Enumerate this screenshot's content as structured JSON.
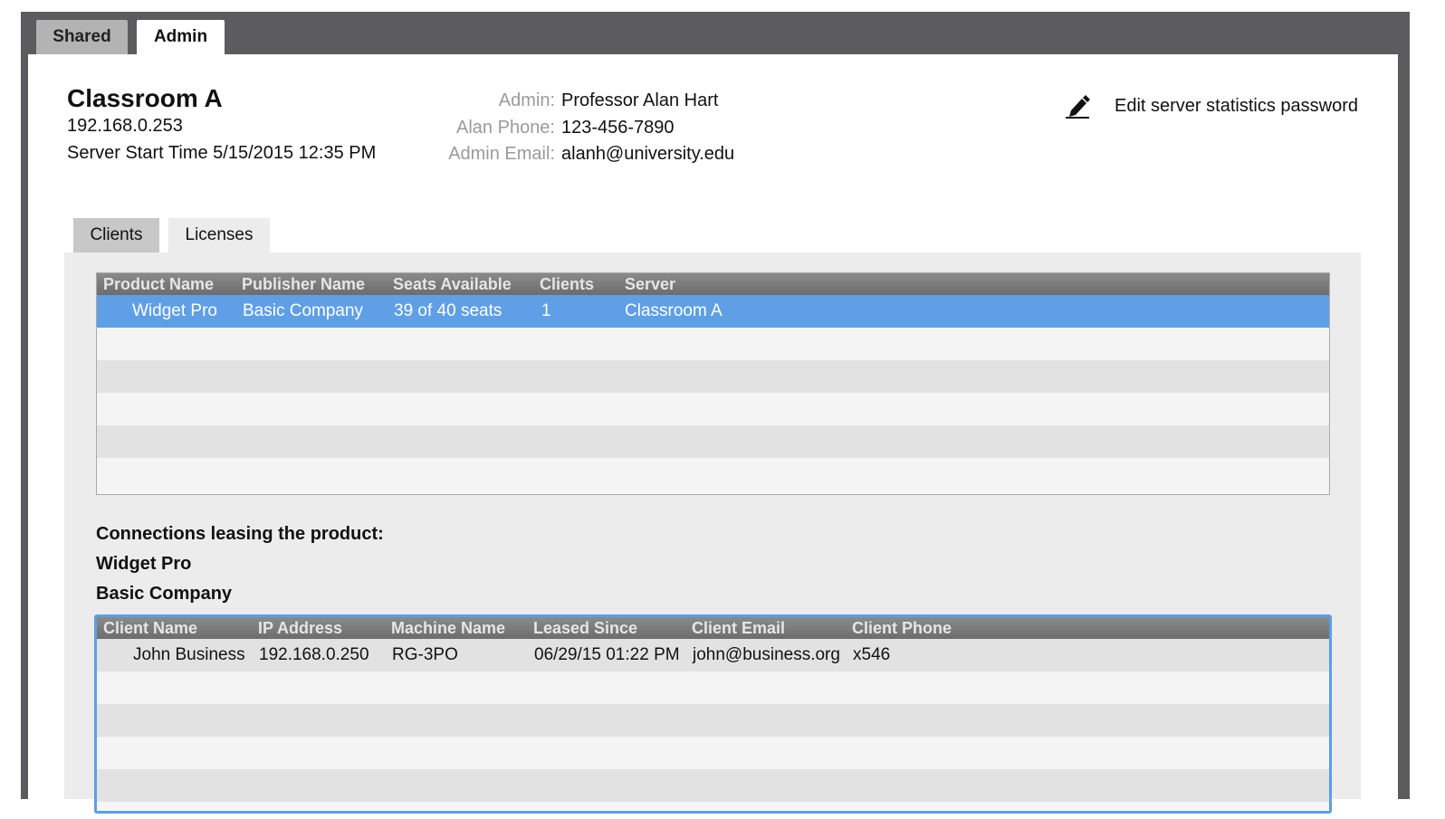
{
  "top_tabs": {
    "shared": "Shared",
    "admin": "Admin"
  },
  "server": {
    "name": "Classroom A",
    "ip": "192.168.0.253",
    "start_time": "Server Start Time 5/15/2015 12:35 PM"
  },
  "admin_info": {
    "admin_label": "Admin:",
    "admin_value": "Professor Alan Hart",
    "phone_label": "Alan Phone:",
    "phone_value": "123-456-7890",
    "email_label": "Admin Email:",
    "email_value": "alanh@university.edu"
  },
  "edit_password": {
    "label": "Edit server statistics password",
    "icon": "pencil-icon"
  },
  "sub_tabs": {
    "clients": "Clients",
    "licenses": "Licenses"
  },
  "products_table": {
    "headers": [
      "Product Name",
      "Publisher Name",
      "Seats Available",
      "Clients",
      "Server"
    ],
    "rows": [
      [
        "Widget Pro",
        "Basic Company",
        "39 of 40 seats",
        "1",
        "Classroom A"
      ]
    ]
  },
  "connections": {
    "heading": "Connections leasing the product:",
    "product": "Widget Pro",
    "publisher": "Basic Company",
    "headers": [
      "Client Name",
      "IP Address",
      "Machine Name",
      "Leased Since",
      "Client Email",
      "Client Phone"
    ],
    "rows": [
      [
        "John Business",
        "192.168.0.250",
        "RG-3PO",
        "06/29/15 01:22 PM",
        "john@business.org",
        "x546"
      ]
    ]
  },
  "colors": {
    "selection": "#5f9fe6",
    "focus_border": "#5b9ee6",
    "header_bg": "#7a7a7a",
    "frame": "#5c5c5e"
  }
}
